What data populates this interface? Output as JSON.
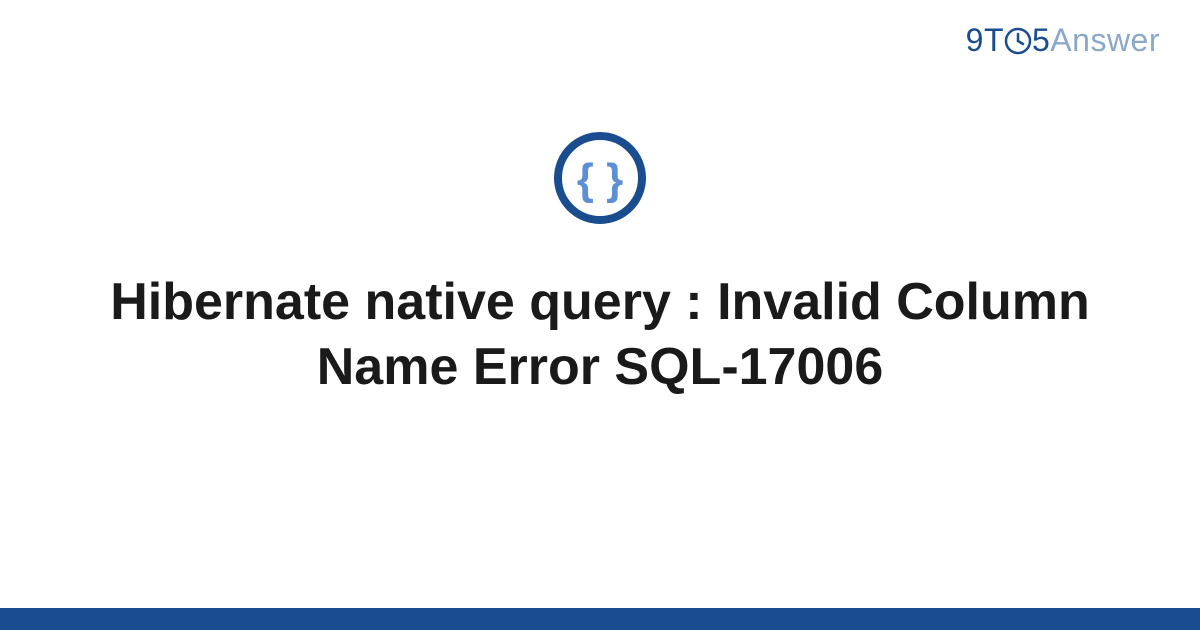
{
  "header": {
    "brand_part1": "9T",
    "brand_part2": "5",
    "brand_part3": "Answer"
  },
  "icon": {
    "name": "code-braces-icon"
  },
  "title": "Hibernate native query : Invalid Column Name Error SQL-17006",
  "colors": {
    "brand_primary": "#1a4d8f",
    "brand_secondary": "#8aa8c8",
    "icon_ring": "#1a4d8f",
    "icon_braces": "#5c8fd6"
  }
}
